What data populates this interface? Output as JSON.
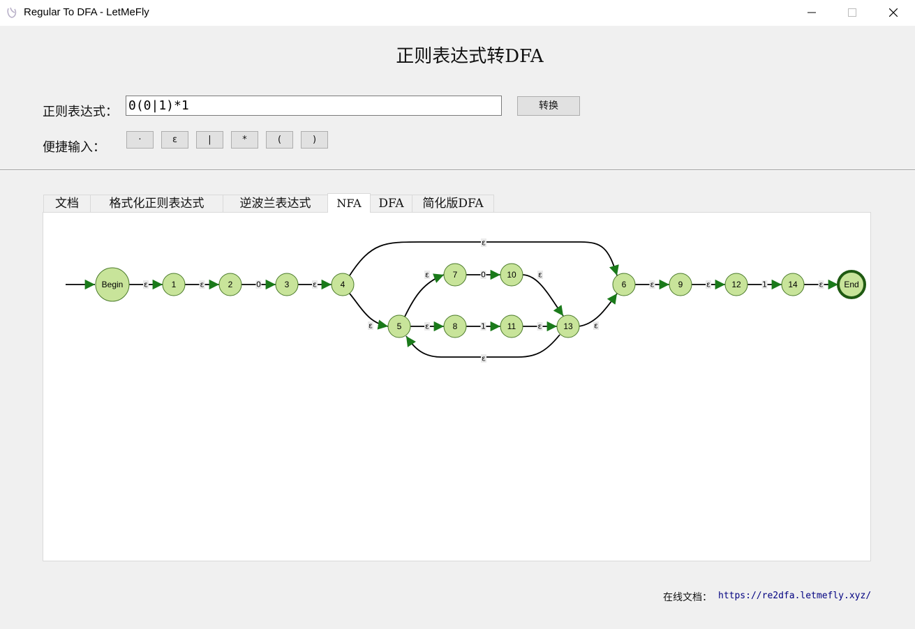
{
  "window": {
    "title": "Regular To DFA - LetMeFly",
    "icon": "app-logo-icon",
    "controls": [
      "minimize-icon",
      "maximize-icon",
      "close-icon"
    ]
  },
  "header": {
    "title": "正则表达式转DFA"
  },
  "form": {
    "regex_label": "正则表达式：",
    "regex_value": "0(0|1)*1",
    "convert_label": "转换",
    "quick_label": "便捷输入：",
    "quick_buttons": [
      "·",
      "ε",
      "|",
      "*",
      "(",
      ")"
    ]
  },
  "tabs": [
    "文档",
    "格式化正则表达式",
    "逆波兰表达式",
    "NFA",
    "DFA",
    "简化版DFA"
  ],
  "active_tab": "NFA",
  "nfa": {
    "nodes": [
      "Begin",
      "1",
      "2",
      "3",
      "4",
      "5",
      "6",
      "7",
      "8",
      "9",
      "10",
      "11",
      "12",
      "13",
      "14",
      "End"
    ],
    "edges": [
      {
        "from": "Begin",
        "to": "1",
        "label": "ε"
      },
      {
        "from": "1",
        "to": "2",
        "label": "ε"
      },
      {
        "from": "2",
        "to": "3",
        "label": "0"
      },
      {
        "from": "3",
        "to": "4",
        "label": "ε"
      },
      {
        "from": "4",
        "to": "6",
        "label": "ε"
      },
      {
        "from": "4",
        "to": "5",
        "label": "ε"
      },
      {
        "from": "5",
        "to": "7",
        "label": "ε"
      },
      {
        "from": "5",
        "to": "8",
        "label": "ε"
      },
      {
        "from": "7",
        "to": "10",
        "label": "0"
      },
      {
        "from": "8",
        "to": "11",
        "label": "1"
      },
      {
        "from": "10",
        "to": "13",
        "label": "ε"
      },
      {
        "from": "11",
        "to": "13",
        "label": "ε"
      },
      {
        "from": "13",
        "to": "5",
        "label": "ε"
      },
      {
        "from": "13",
        "to": "6",
        "label": "ε"
      },
      {
        "from": "6",
        "to": "9",
        "label": "ε"
      },
      {
        "from": "9",
        "to": "12",
        "label": "ε"
      },
      {
        "from": "12",
        "to": "14",
        "label": "1"
      },
      {
        "from": "14",
        "to": "End",
        "label": "ε"
      }
    ],
    "node_color": "#c8e49a",
    "arrow_color": "#1a7a1a",
    "final_border_color": "#1f5a12"
  },
  "footer": {
    "label": "在线文档：",
    "link": "https://re2dfa.letmefly.xyz/",
    "link_color": "#000080"
  }
}
